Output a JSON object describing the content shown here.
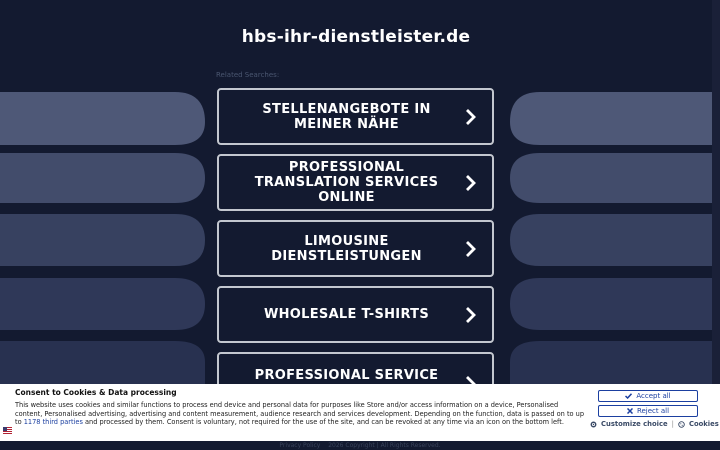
{
  "header": {
    "domain": "hbs-ihr-dienstleister.de"
  },
  "related": {
    "label": "Related Searches:",
    "items": [
      {
        "label": "STELLENANGEBOTE IN MEINER NÄHE"
      },
      {
        "label": "PROFESSIONAL TRANSLATION SERVICES ONLINE"
      },
      {
        "label": "LIMOUSINE DIENSTLEISTUNGEN"
      },
      {
        "label": "WHOLESALE T-SHIRTS"
      },
      {
        "label": "PROFESSIONAL SERVICE"
      }
    ]
  },
  "consent": {
    "title": "Consent to Cookies & Data processing",
    "text_before": "This website uses cookies and similar functions to process end device and personal data for purposes like Store and/or access information on a device, Personalised content, Personalised advertising, advertising and content measurement, audience research and services development. Depending on the function, data is passed on to up to ",
    "link": "1178 third parties",
    "text_after": " and processed by them. Consent is voluntary, not required for the use of the site, and can be revoked at any time via an icon on the bottom left.",
    "accept_label": "Accept all",
    "reject_label": "Reject all",
    "customize_label": "Customize choice",
    "cookies_label": "Cookies"
  },
  "footer": {
    "privacy": "Privacy Policy",
    "copyright": "2026 Copyright | All Rights Reserved."
  },
  "colors": {
    "background": "#131a30",
    "accent": "#1b3fa0"
  }
}
